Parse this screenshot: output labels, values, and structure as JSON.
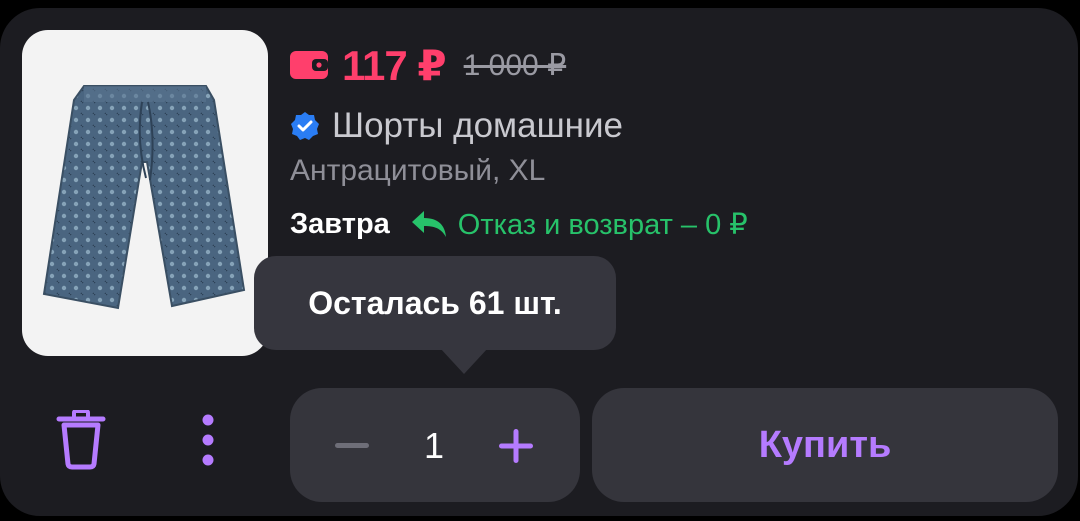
{
  "product": {
    "price": "117 ₽",
    "old_price": "1 000 ₽",
    "title": "Шорты домашние",
    "variant": "Антрацитовый, XL",
    "image_icon": "shorts-image",
    "verified_icon": "verified-check-icon",
    "wallet_icon": "wallet-icon"
  },
  "delivery": {
    "day": "Завтра",
    "return_text": "Отказ и возврат – 0 ₽",
    "return_icon": "return-arrow-icon"
  },
  "tooltip": {
    "text": "Осталась 61 шт."
  },
  "actions": {
    "trash_icon": "trash-icon",
    "more_icon": "more-vertical-icon",
    "quantity": "1",
    "minus_icon": "minus-icon",
    "plus_icon": "plus-icon",
    "buy_label": "Купить"
  },
  "colors": {
    "card_bg": "#1c1c21",
    "price": "#ff3f6c",
    "accent": "#b57bff",
    "return_green": "#27c26a",
    "verified_blue": "#2a7df4"
  }
}
